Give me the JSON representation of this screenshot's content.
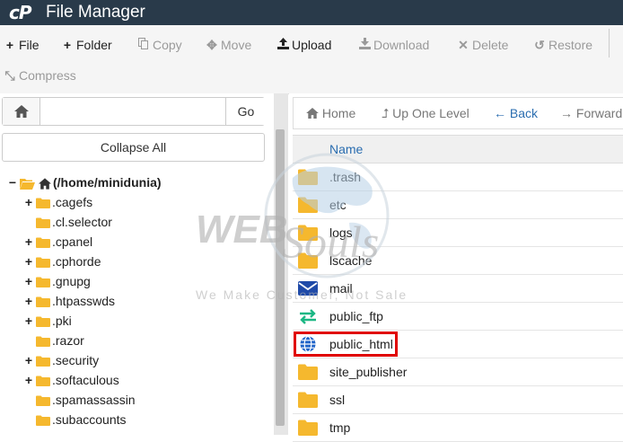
{
  "app": {
    "logo": "cP",
    "title": "File Manager"
  },
  "toolbar": {
    "file": "File",
    "folder": "Folder",
    "copy": "Copy",
    "move": "Move",
    "upload": "Upload",
    "download": "Download",
    "delete": "Delete",
    "restore": "Restore",
    "compress": "Compress"
  },
  "sidebar": {
    "search_value": "",
    "go_label": "Go",
    "collapse_label": "Collapse All",
    "root_label": "(/home/minidunia)",
    "items": [
      {
        "label": ".cagefs",
        "expandable": true
      },
      {
        "label": ".cl.selector",
        "expandable": false
      },
      {
        "label": ".cpanel",
        "expandable": true
      },
      {
        "label": ".cphorde",
        "expandable": true
      },
      {
        "label": ".gnupg",
        "expandable": true
      },
      {
        "label": ".htpasswds",
        "expandable": true
      },
      {
        "label": ".pki",
        "expandable": true
      },
      {
        "label": ".razor",
        "expandable": false
      },
      {
        "label": ".security",
        "expandable": true
      },
      {
        "label": ".softaculous",
        "expandable": true
      },
      {
        "label": ".spamassassin",
        "expandable": false
      },
      {
        "label": ".subaccounts",
        "expandable": false
      }
    ]
  },
  "nav": {
    "home": "Home",
    "up": "Up One Level",
    "back": "Back",
    "forward": "Forward"
  },
  "filelist": {
    "header_name": "Name",
    "rows": [
      {
        "name": ".trash",
        "icon": "folder-icon"
      },
      {
        "name": "etc",
        "icon": "folder-icon"
      },
      {
        "name": "logs",
        "icon": "folder-icon"
      },
      {
        "name": "lscache",
        "icon": "folder-icon"
      },
      {
        "name": "mail",
        "icon": "mail-icon"
      },
      {
        "name": "public_ftp",
        "icon": "transfer-icon"
      },
      {
        "name": "public_html",
        "icon": "globe-icon",
        "highlighted": true
      },
      {
        "name": "site_publisher",
        "icon": "folder-icon"
      },
      {
        "name": "ssl",
        "icon": "folder-icon"
      },
      {
        "name": "tmp",
        "icon": "folder-icon"
      }
    ]
  },
  "watermark": {
    "brand_a": "WEB",
    "brand_b": "Souls",
    "tagline": "We Make Customer, Not Sale"
  },
  "colors": {
    "titlebar": "#293a4a",
    "folder": "#f5b82e",
    "link": "#2a6db0",
    "highlight": "#e00000"
  }
}
